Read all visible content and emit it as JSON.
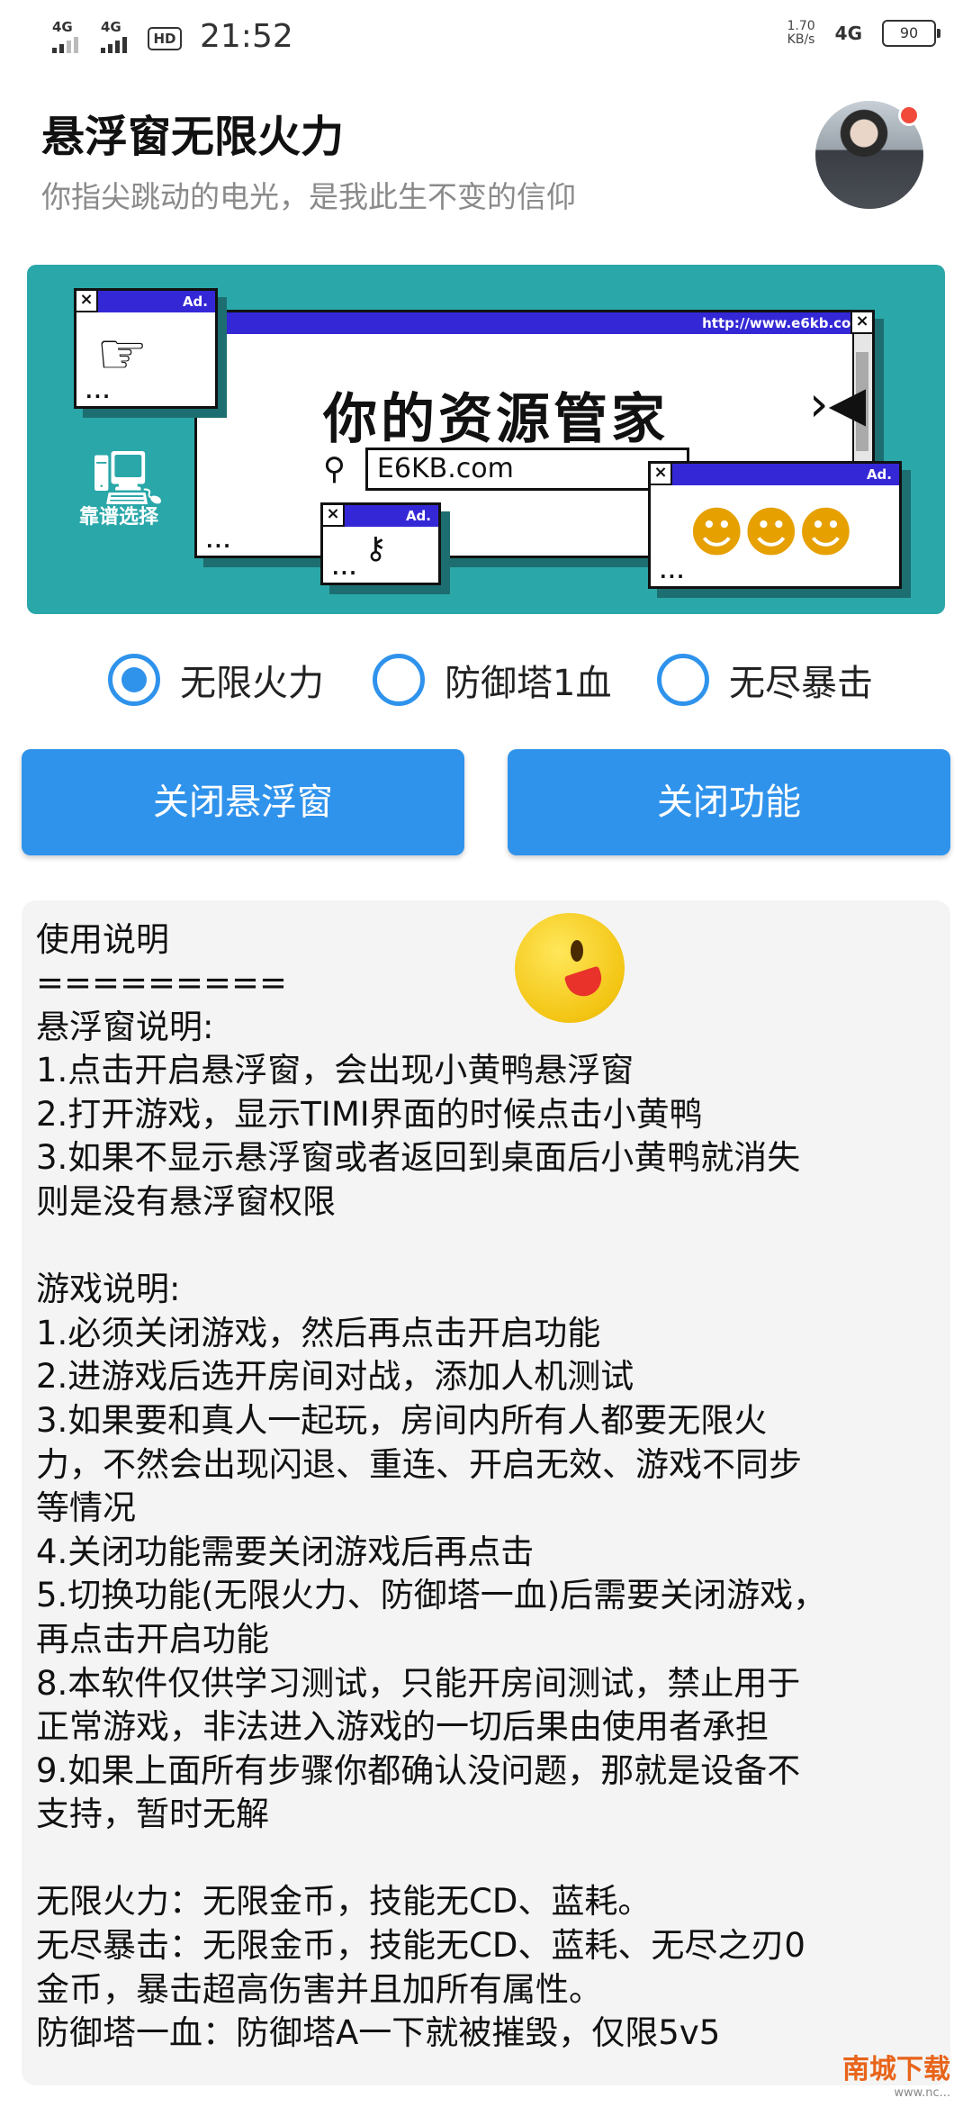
{
  "status_bar": {
    "signal1": "4G",
    "signal2": "4G",
    "hd": "HD",
    "time": "21:52",
    "speed_value": "1.70",
    "speed_unit": "KB/s",
    "network": "4G",
    "battery": "90"
  },
  "header": {
    "title": "悬浮窗无限火力",
    "subtitle": "你指尖跳动的电光，是我此生不变的信仰"
  },
  "banner": {
    "ad_label": "Ad.",
    "url": "http://www.e6kb.com",
    "slogan": "你的资源管家",
    "search_value": "E6KB.com",
    "pc_label": "靠谱选择"
  },
  "modes": [
    {
      "label": "无限火力",
      "selected": true
    },
    {
      "label": "防御塔1血",
      "selected": false
    },
    {
      "label": "无尽暴击",
      "selected": false
    }
  ],
  "buttons": {
    "close_float": "关闭悬浮窗",
    "close_function": "关闭功能"
  },
  "instructions": {
    "title": "使用说明",
    "body": "=========\n悬浮窗说明:\n1.点击开启悬浮窗，会出现小黄鸭悬浮窗\n2.打开游戏，显示TIMI界面的时候点击小黄鸭\n3.如果不显示悬浮窗或者返回到桌面后小黄鸭就消失\n则是没有悬浮窗权限\n\n游戏说明:\n1.必须关闭游戏，然后再点击开启功能\n2.进游戏后选开房间对战，添加人机测试\n3.如果要和真人一起玩，房间内所有人都要无限火\n力，不然会出现闪退、重连、开启无效、游戏不同步\n等情况\n4.关闭功能需要关闭游戏后再点击\n5.切换功能(无限火力、防御塔一血)后需要关闭游戏，\n再点击开启功能\n8.本软件仅供学习测试，只能开房间测试，禁止用于\n正常游戏，非法进入游戏的一切后果由使用者承担\n9.如果上面所有步骤你都确认没问题，那就是设备不\n支持，暂时无解\n\n无限火力：无限金币，技能无CD、蓝耗。\n无尽暴击：无限金币，技能无CD、蓝耗、无尽之刃0\n金币，暴击超高伤害并且加所有属性。\n防御塔一血：防御塔A一下就被摧毁，仅限5v5"
  },
  "watermark": {
    "brand": "南城下载",
    "site": "www.nc..."
  },
  "colors": {
    "accent": "#2f93ec",
    "banner_bg": "#2aa7a9",
    "window_titlebar": "#3428d6",
    "badge_dot": "#f24a3a"
  }
}
